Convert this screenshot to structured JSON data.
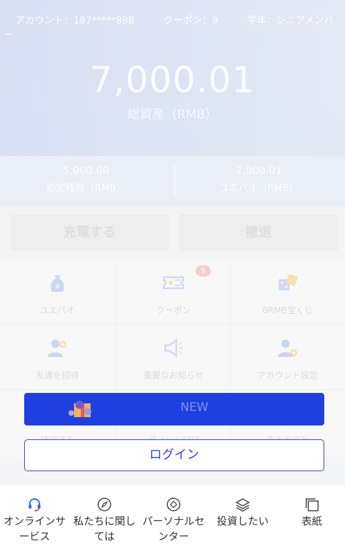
{
  "header": {
    "account": "アカウント：187*****888",
    "coupons": "クーポン：9",
    "level": "学年：シニアメンバー",
    "total_value": "7,000.01",
    "total_label": "総資産（RMB）"
  },
  "balances": [
    {
      "value": "5,000.00",
      "label": "勘定残高（RMB）"
    },
    {
      "value": "2,000.01",
      "label": "ユエバオ（RMB）"
    }
  ],
  "actions": {
    "charge": "充電する",
    "withdraw": "撤退"
  },
  "grid": [
    {
      "label": "ユエバオ",
      "icon": "money-bag-icon"
    },
    {
      "label": "クーポン",
      "icon": "ticket-icon",
      "badge": "9"
    },
    {
      "label": "0RMB宝くじ",
      "icon": "dice-icon"
    },
    {
      "label": "友達を招待",
      "icon": "invite-user-icon"
    },
    {
      "label": "重要なお知らせ",
      "icon": "megaphone-icon"
    },
    {
      "label": "アカウント設定",
      "icon": "user-settings-icon"
    },
    {
      "label": "確認済み",
      "icon": "verified-icon"
    },
    {
      "label": "ポイント記録",
      "icon": "points-icon"
    },
    {
      "label": "資本の流れ",
      "icon": "document-icon"
    }
  ],
  "banner": {
    "text": "NEW"
  },
  "login_label": "ログイン",
  "tabs": [
    {
      "label": "オンラインサービス",
      "icon": "headset-icon",
      "active": true
    },
    {
      "label": "私たちに関しては",
      "icon": "compass-icon"
    },
    {
      "label": "パーソナルセンター",
      "icon": "target-icon"
    },
    {
      "label": "投資したい",
      "icon": "layers-icon"
    },
    {
      "label": "表紙",
      "icon": "window-icon"
    }
  ],
  "colors": {
    "accent": "#2f46d3",
    "banner": "#1f3fe0",
    "badge": "#f5c6c6",
    "headset": "#2a6df4"
  }
}
